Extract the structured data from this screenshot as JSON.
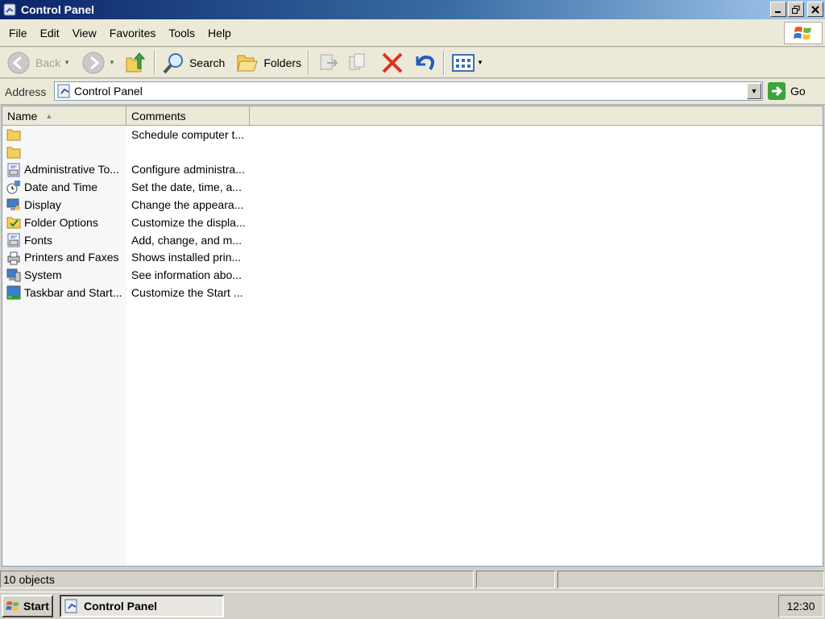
{
  "window": {
    "title": "Control Panel"
  },
  "menu": [
    "File",
    "Edit",
    "View",
    "Favorites",
    "Tools",
    "Help"
  ],
  "toolbar": {
    "back_label": "Back",
    "search_label": "Search",
    "folders_label": "Folders"
  },
  "address": {
    "label": "Address",
    "value": "Control Panel",
    "go_label": "Go"
  },
  "list": {
    "columns": [
      "Name",
      "Comments"
    ],
    "sorted_by": "Name",
    "rows": [
      {
        "name": "",
        "comment": "Schedule computer t...",
        "icon": "folder-icon"
      },
      {
        "name": "",
        "comment": "",
        "icon": "folder-icon"
      },
      {
        "name": "Administrative To...",
        "comment": "Configure administra...",
        "icon": "admin-tools-icon"
      },
      {
        "name": "Date and Time",
        "comment": "Set the date, time, a...",
        "icon": "date-time-icon"
      },
      {
        "name": "Display",
        "comment": "Change the appeara...",
        "icon": "display-icon"
      },
      {
        "name": "Folder Options",
        "comment": "Customize the displa...",
        "icon": "folder-options-icon"
      },
      {
        "name": "Fonts",
        "comment": "Add, change, and m...",
        "icon": "fonts-icon"
      },
      {
        "name": "Printers and Faxes",
        "comment": "Shows installed prin...",
        "icon": "printers-icon"
      },
      {
        "name": "System",
        "comment": "See information abo...",
        "icon": "system-icon"
      },
      {
        "name": "Taskbar and Start...",
        "comment": "Customize the Start ...",
        "icon": "taskbar-icon"
      }
    ]
  },
  "status": {
    "count": "10 objects"
  },
  "taskbar": {
    "start_label": "Start",
    "task_label": "Control Panel",
    "clock": "12:30"
  },
  "colors": {
    "titlebar_start": "#0a246a",
    "titlebar_end": "#a6caf0",
    "chrome": "#ece9d8",
    "classic_face": "#d4d0c8"
  }
}
